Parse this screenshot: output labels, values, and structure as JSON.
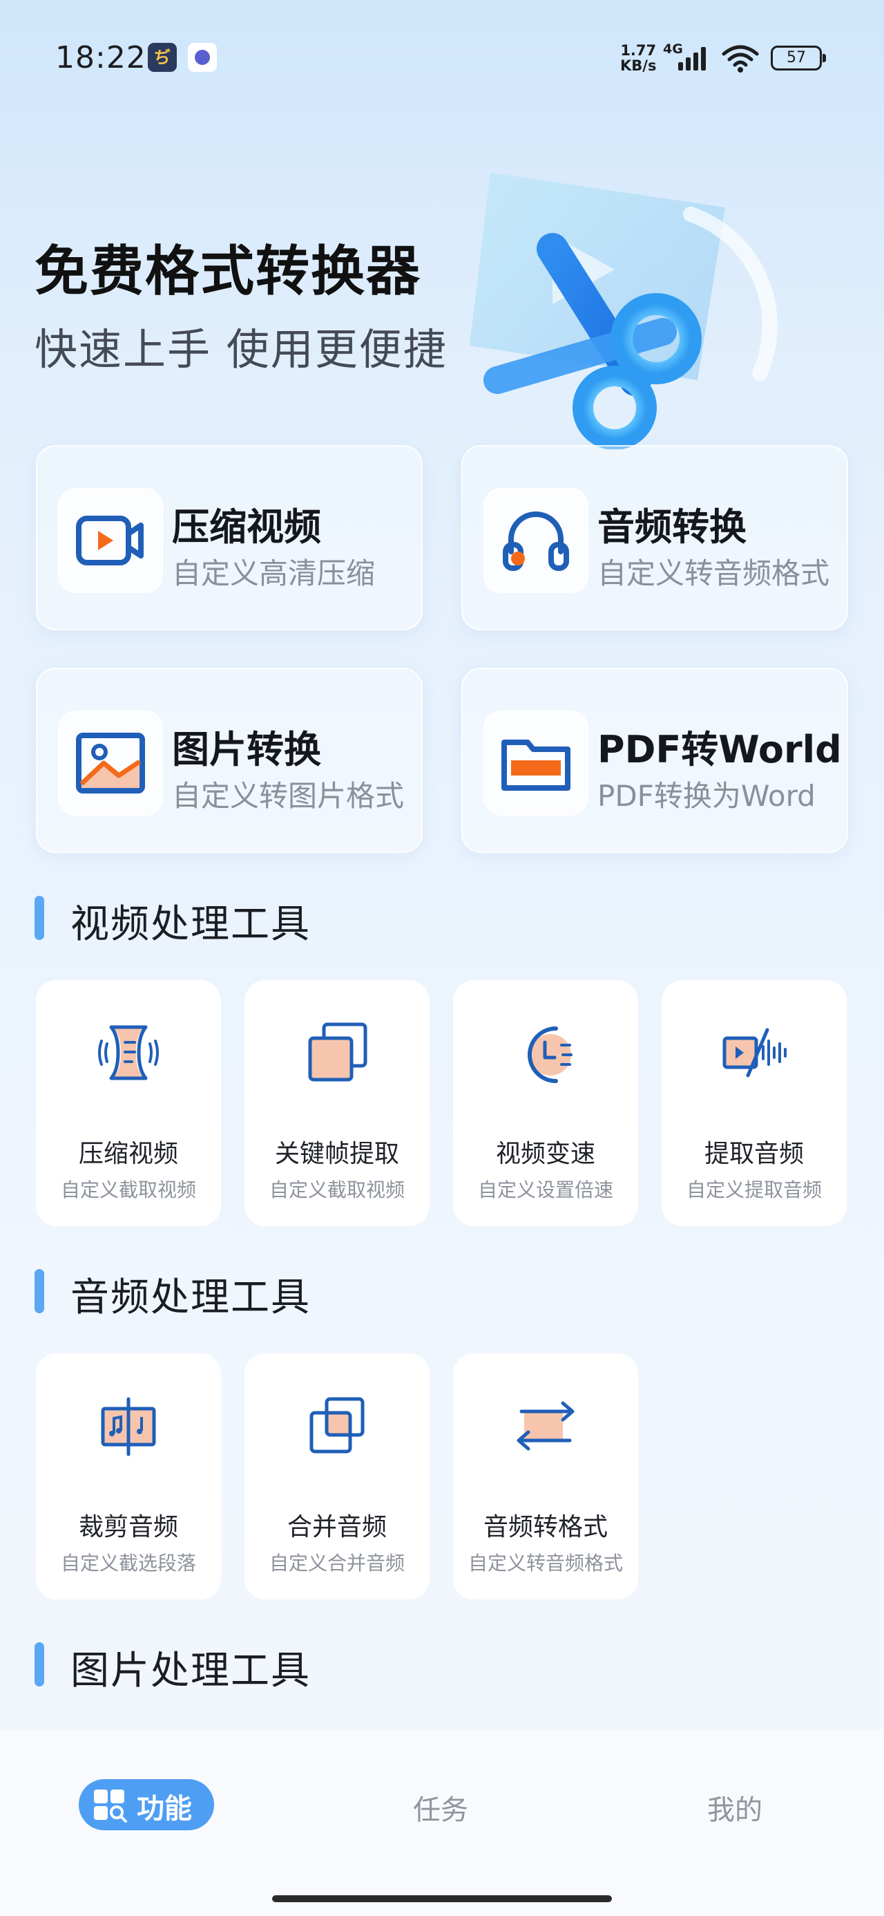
{
  "status_bar": {
    "time": "18:22",
    "app_icon_a_letter": "ぢ",
    "net_speed_value": "1.77",
    "net_speed_unit": "KB/s",
    "network_type": "4G",
    "battery": "57",
    "icons": [
      "signal-icon",
      "wifi-icon",
      "battery-icon"
    ]
  },
  "hero": {
    "title": "免费格式转换器",
    "subtitle": "快速上手 使用更便捷"
  },
  "feature_cards": [
    {
      "title": "压缩视频",
      "subtitle": "自定义高清压缩",
      "icon": "video-camera-icon"
    },
    {
      "title": "音频转换",
      "subtitle": "自定义转音频格式",
      "icon": "headphones-icon"
    },
    {
      "title": "图片转换",
      "subtitle": "自定义转图片格式",
      "icon": "image-icon"
    },
    {
      "title": "PDF转World",
      "subtitle": "PDF转换为Word",
      "icon": "folder-icon"
    }
  ],
  "sections": {
    "video": {
      "title": "视频处理工具",
      "tools": [
        {
          "title": "压缩视频",
          "subtitle": "自定义截取视频",
          "icon": "compress-video-icon"
        },
        {
          "title": "关键帧提取",
          "subtitle": "自定义截取视频",
          "icon": "keyframe-icon"
        },
        {
          "title": "视频变速",
          "subtitle": "自定义设置倍速",
          "icon": "speed-icon"
        },
        {
          "title": "提取音频",
          "subtitle": "自定义提取音频",
          "icon": "extract-audio-icon"
        }
      ]
    },
    "audio": {
      "title": "音频处理工具",
      "tools": [
        {
          "title": "裁剪音频",
          "subtitle": "自定义截选段落",
          "icon": "cut-audio-icon"
        },
        {
          "title": "合并音频",
          "subtitle": "自定义合并音频",
          "icon": "merge-audio-icon"
        },
        {
          "title": "音频转格式",
          "subtitle": "自定义转音频格式",
          "icon": "convert-audio-icon"
        }
      ]
    },
    "image": {
      "title": "图片处理工具"
    }
  },
  "bottom_nav": {
    "items": [
      {
        "label": "功能",
        "active": true,
        "icon": "grid-search-icon"
      },
      {
        "label": "任务",
        "active": false
      },
      {
        "label": "我的",
        "active": false
      }
    ]
  },
  "colors": {
    "accent": "#4e9ef3",
    "icon_blue": "#1f5fb8",
    "icon_orange": "#f56a1a",
    "icon_peach": "#f7c5ad",
    "section_bar": "#5aa8f5"
  }
}
